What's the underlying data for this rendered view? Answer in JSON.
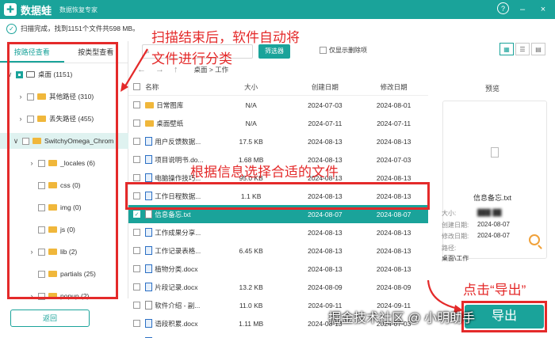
{
  "app": {
    "name": "数据蛙",
    "subtitle": "数据恢复专家",
    "logo_letter": "✚"
  },
  "window_controls": {
    "help": "?",
    "minimize": "–",
    "close": "×"
  },
  "status": {
    "text": "扫描完成，找到1151个文件共598 MB。"
  },
  "left_tabs": [
    "按路径查看",
    "按类型查看"
  ],
  "tree": [
    {
      "label": "桌面 (1151)",
      "arrow": "∨",
      "checkbox": "partial",
      "icon": "drive"
    },
    {
      "label": "其他路径 (310)",
      "arrow": "›",
      "checkbox": "empty",
      "icon": "folder"
    },
    {
      "label": "丢失路径 (455)",
      "arrow": "›",
      "checkbox": "empty",
      "icon": "folder"
    },
    {
      "label": "SwitchyOmega_Chrom",
      "arrow": "∨",
      "checkbox": "empty",
      "icon": "folder"
    },
    {
      "label": "_locales (6)",
      "arrow": "›",
      "checkbox": "empty",
      "icon": "folder"
    },
    {
      "label": "css (0)",
      "arrow": "",
      "checkbox": "empty",
      "icon": "folder"
    },
    {
      "label": "img (0)",
      "arrow": "",
      "checkbox": "empty",
      "icon": "folder"
    },
    {
      "label": "js (0)",
      "arrow": "",
      "checkbox": "empty",
      "icon": "folder"
    },
    {
      "label": "lib (2)",
      "arrow": "›",
      "checkbox": "empty",
      "icon": "folder"
    },
    {
      "label": "partials (25)",
      "arrow": "",
      "checkbox": "empty",
      "icon": "folder"
    },
    {
      "label": "popup (2)",
      "arrow": "›",
      "checkbox": "empty",
      "icon": "folder"
    }
  ],
  "toolbar": {
    "search_placeholder": "",
    "filter_label": "筛选器",
    "only_deleted_label": "仅显示删除项"
  },
  "nav": {
    "back": "←",
    "forward": "→",
    "up": "↑",
    "breadcrumb": "桌面 > 工作"
  },
  "table": {
    "headers": {
      "name": "名称",
      "size": "大小",
      "created": "创建日期",
      "modified": "修改日期"
    },
    "rows": [
      {
        "name": "日常图库",
        "size": "N/A",
        "created": "2024-07-03",
        "modified": "2024-08-01",
        "type": "folder"
      },
      {
        "name": "桌面壁纸",
        "size": "N/A",
        "created": "2024-07-11",
        "modified": "2024-07-11",
        "type": "folder"
      },
      {
        "name": "用户反馈数据...",
        "size": "17.5 KB",
        "created": "2024-08-13",
        "modified": "2024-08-13",
        "type": "sheet"
      },
      {
        "name": "项目说明书.do...",
        "size": "1.68 MB",
        "created": "2024-08-13",
        "modified": "2024-07-03",
        "type": "doc"
      },
      {
        "name": "电脑操作技巧...",
        "size": "95.0 KB",
        "created": "2024-08-13",
        "modified": "2024-08-13",
        "type": "doc"
      },
      {
        "name": "工作日程数据...",
        "size": "1.1 KB",
        "created": "2024-08-13",
        "modified": "2024-08-13",
        "type": "sheet"
      },
      {
        "name": "信息备忘.txt",
        "size": "",
        "created": "2024-08-07",
        "modified": "2024-08-07",
        "type": "txt",
        "selected": true
      },
      {
        "name": "工作成果分享...",
        "size": "",
        "created": "2024-08-13",
        "modified": "2024-08-13",
        "type": "doc"
      },
      {
        "name": "工作记录表格...",
        "size": "6.45 KB",
        "created": "2024-08-13",
        "modified": "2024-08-13",
        "type": "sheet"
      },
      {
        "name": "植物分类.docx",
        "size": "",
        "created": "2024-08-13",
        "modified": "2024-08-13",
        "type": "doc"
      },
      {
        "name": "片段记录.docx",
        "size": "13.2 KB",
        "created": "2024-08-09",
        "modified": "2024-08-09",
        "type": "doc"
      },
      {
        "name": "软件介绍 - 副...",
        "size": "11.0 KB",
        "created": "2024-09-11",
        "modified": "2024-09-11",
        "type": "txt"
      },
      {
        "name": "语段积累.docx",
        "size": "1.11 MB",
        "created": "2024-08-13",
        "modified": "2024-07-03",
        "type": "doc"
      },
      {
        "name": "3周总结.docx",
        "size": "1.33 MB",
        "created": "2024-08-13",
        "modified": "2024-08-13",
        "type": "doc"
      }
    ]
  },
  "preview": {
    "title": "预览",
    "filename": "信息备忘.txt",
    "size_label": "大小:",
    "created_label": "创建日期:",
    "created_value": "2024-08-07",
    "modified_label": "修改日期:",
    "modified_value": "2024-08-07",
    "path_label": "路径:",
    "path_value": "桌面\\工作"
  },
  "buttons": {
    "back": "返回",
    "export": "导出"
  },
  "annotations": {
    "top": "扫描结束后，软件自动将",
    "top2": "文件进行分类",
    "middle": "根据信息选择合适的文件",
    "bottom": "点击“导出”"
  },
  "watermark": "掘金技术社区 @ 小明助手",
  "colors": {
    "accent": "#1aa39a",
    "annotation": "#e42a2a"
  }
}
